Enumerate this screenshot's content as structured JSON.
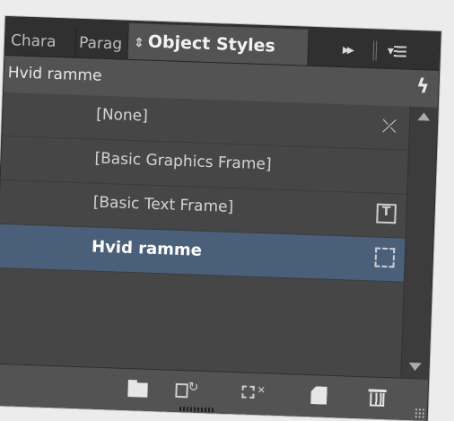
{
  "tabs": {
    "tab1": "Chara",
    "tab2": "Parag",
    "active": "Object Styles",
    "active_icon": "up-down-arrows-icon"
  },
  "controls": {
    "expand": "▸▸",
    "menu_icon": "panel-menu-icon"
  },
  "header": {
    "current_style": "Hvid ramme",
    "icon": "lightning-bolt-icon"
  },
  "styles": [
    {
      "label": "[None]",
      "icon": "clear-override-icon",
      "selected": false
    },
    {
      "label": "[Basic Graphics Frame]",
      "icon": "",
      "selected": false
    },
    {
      "label": "[Basic Text Frame]",
      "icon": "text-frame-icon",
      "selected": false
    },
    {
      "label": "Hvid ramme",
      "icon": "graphic-frame-icon",
      "selected": true
    }
  ],
  "footer": {
    "buttons": [
      "folder-icon",
      "load-styles-icon",
      "clear-overrides-icon",
      "new-style-icon",
      "trash-icon"
    ]
  },
  "colors": {
    "panel_bg": "#535353",
    "list_bg": "#464646",
    "selection": "#4a5f7a"
  }
}
